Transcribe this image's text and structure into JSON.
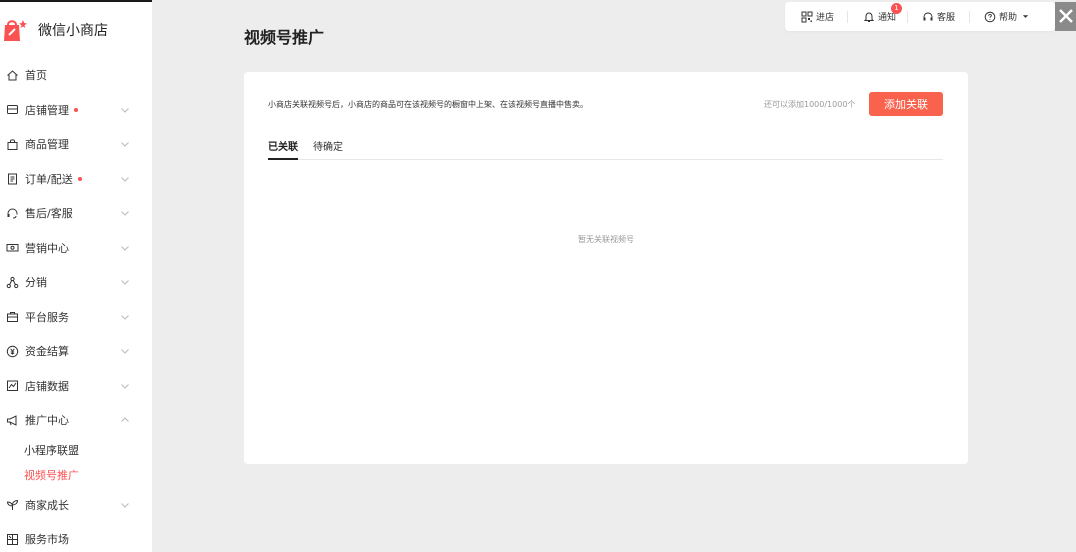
{
  "app": {
    "title": "微信小商店",
    "brand_color": "#fa5151",
    "accent_button_color": "#f9634e"
  },
  "sidebar": {
    "items": [
      {
        "label": "首页",
        "icon": "home-icon",
        "dot": false,
        "chevron": ""
      },
      {
        "label": "店铺管理",
        "icon": "store-icon",
        "dot": true,
        "chevron": "down"
      },
      {
        "label": "商品管理",
        "icon": "shopping-bag-icon",
        "dot": false,
        "chevron": "down"
      },
      {
        "label": "订单/配送",
        "icon": "order-clipboard-icon",
        "dot": true,
        "chevron": "down"
      },
      {
        "label": "售后/客服",
        "icon": "headset-icon",
        "dot": false,
        "chevron": "down"
      },
      {
        "label": "营销中心",
        "icon": "ticket-icon",
        "dot": false,
        "chevron": "down"
      },
      {
        "label": "分销",
        "icon": "share-nodes-icon",
        "dot": false,
        "chevron": "down"
      },
      {
        "label": "平台服务",
        "icon": "briefcase-icon",
        "dot": false,
        "chevron": "down"
      },
      {
        "label": "资金结算",
        "icon": "yen-circle-icon",
        "dot": false,
        "chevron": "down"
      },
      {
        "label": "店铺数据",
        "icon": "chart-icon",
        "dot": false,
        "chevron": "down"
      },
      {
        "label": "推广中心",
        "icon": "megaphone-icon",
        "dot": false,
        "chevron": "up"
      }
    ],
    "promotion_sub": [
      {
        "label": "小程序联盟",
        "active": false
      },
      {
        "label": "视频号推广",
        "active": true
      }
    ],
    "items_after": [
      {
        "label": "商家成长",
        "icon": "sprout-icon",
        "dot": false,
        "chevron": "down"
      },
      {
        "label": "服务市场",
        "icon": "market-grid-icon",
        "dot": false,
        "chevron": ""
      }
    ]
  },
  "topbar": {
    "enter_store": "进店",
    "notifications": "通知",
    "notification_count": "1",
    "customer_service": "客服",
    "help": "帮助"
  },
  "main": {
    "page_title": "视频号推广",
    "notice": "小商店关联视频号后，小商店的商品可在该视频号的橱窗中上架、在该视频号直播中售卖。",
    "remaining": "还可以添加1000/1000个",
    "add_button": "添加关联",
    "tabs": [
      {
        "label": "已关联",
        "active": true
      },
      {
        "label": "待确定",
        "active": false
      }
    ],
    "empty_text": "暂无关联视频号"
  }
}
